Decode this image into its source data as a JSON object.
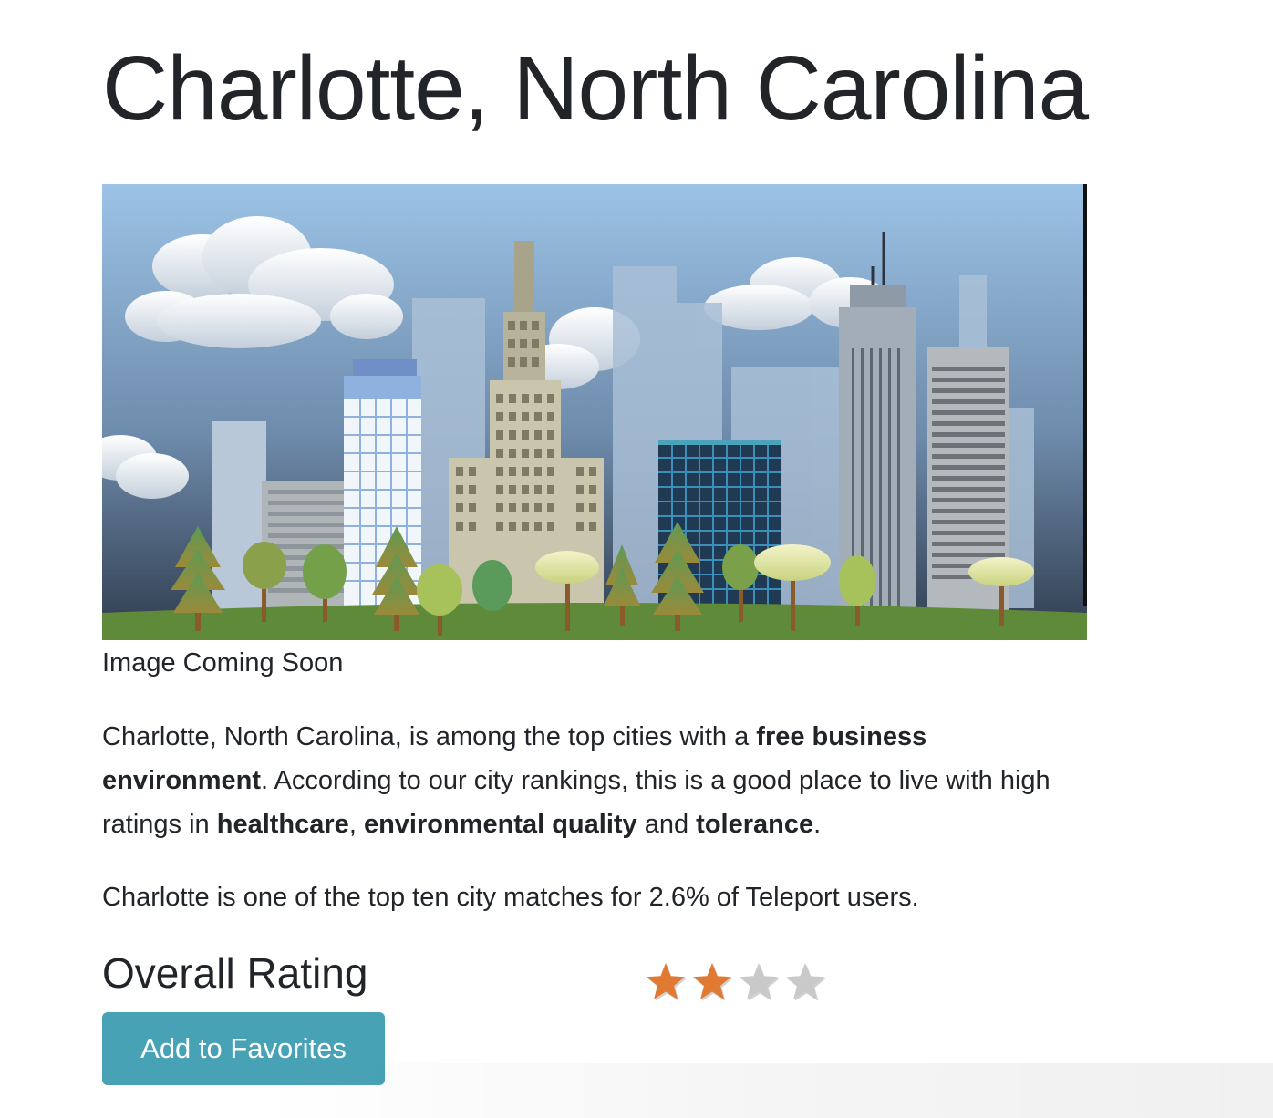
{
  "city": {
    "title": "Charlotte, North Carolina"
  },
  "image": {
    "caption": "Image Coming Soon",
    "colors": {
      "sky_top": "#9cc3e6",
      "sky_bottom": "#3a4a5e",
      "grass": "#5f8a3a"
    }
  },
  "description": {
    "part1": "Charlotte, North Carolina, is among the top cities with a ",
    "bold1": "free business environment",
    "part2": ". According to our city rankings, this is a good place to live with high ratings in ",
    "bold2": "healthcare",
    "part3": ", ",
    "bold3": "environmental quality",
    "part4": " and ",
    "bold4": "tolerance",
    "part5": "."
  },
  "matches": {
    "text": "Charlotte is one of the top ten city matches for 2.6% of Teleport users."
  },
  "rating": {
    "heading": "Overall Rating",
    "value": 2.0,
    "max": 5,
    "star_count": 4,
    "filled_stars": 2,
    "colors": {
      "filled": "#e07a32",
      "empty": "#c9c9c9"
    }
  },
  "actions": {
    "favorites_label": "Add to Favorites",
    "button_color": "#48a2b6"
  }
}
